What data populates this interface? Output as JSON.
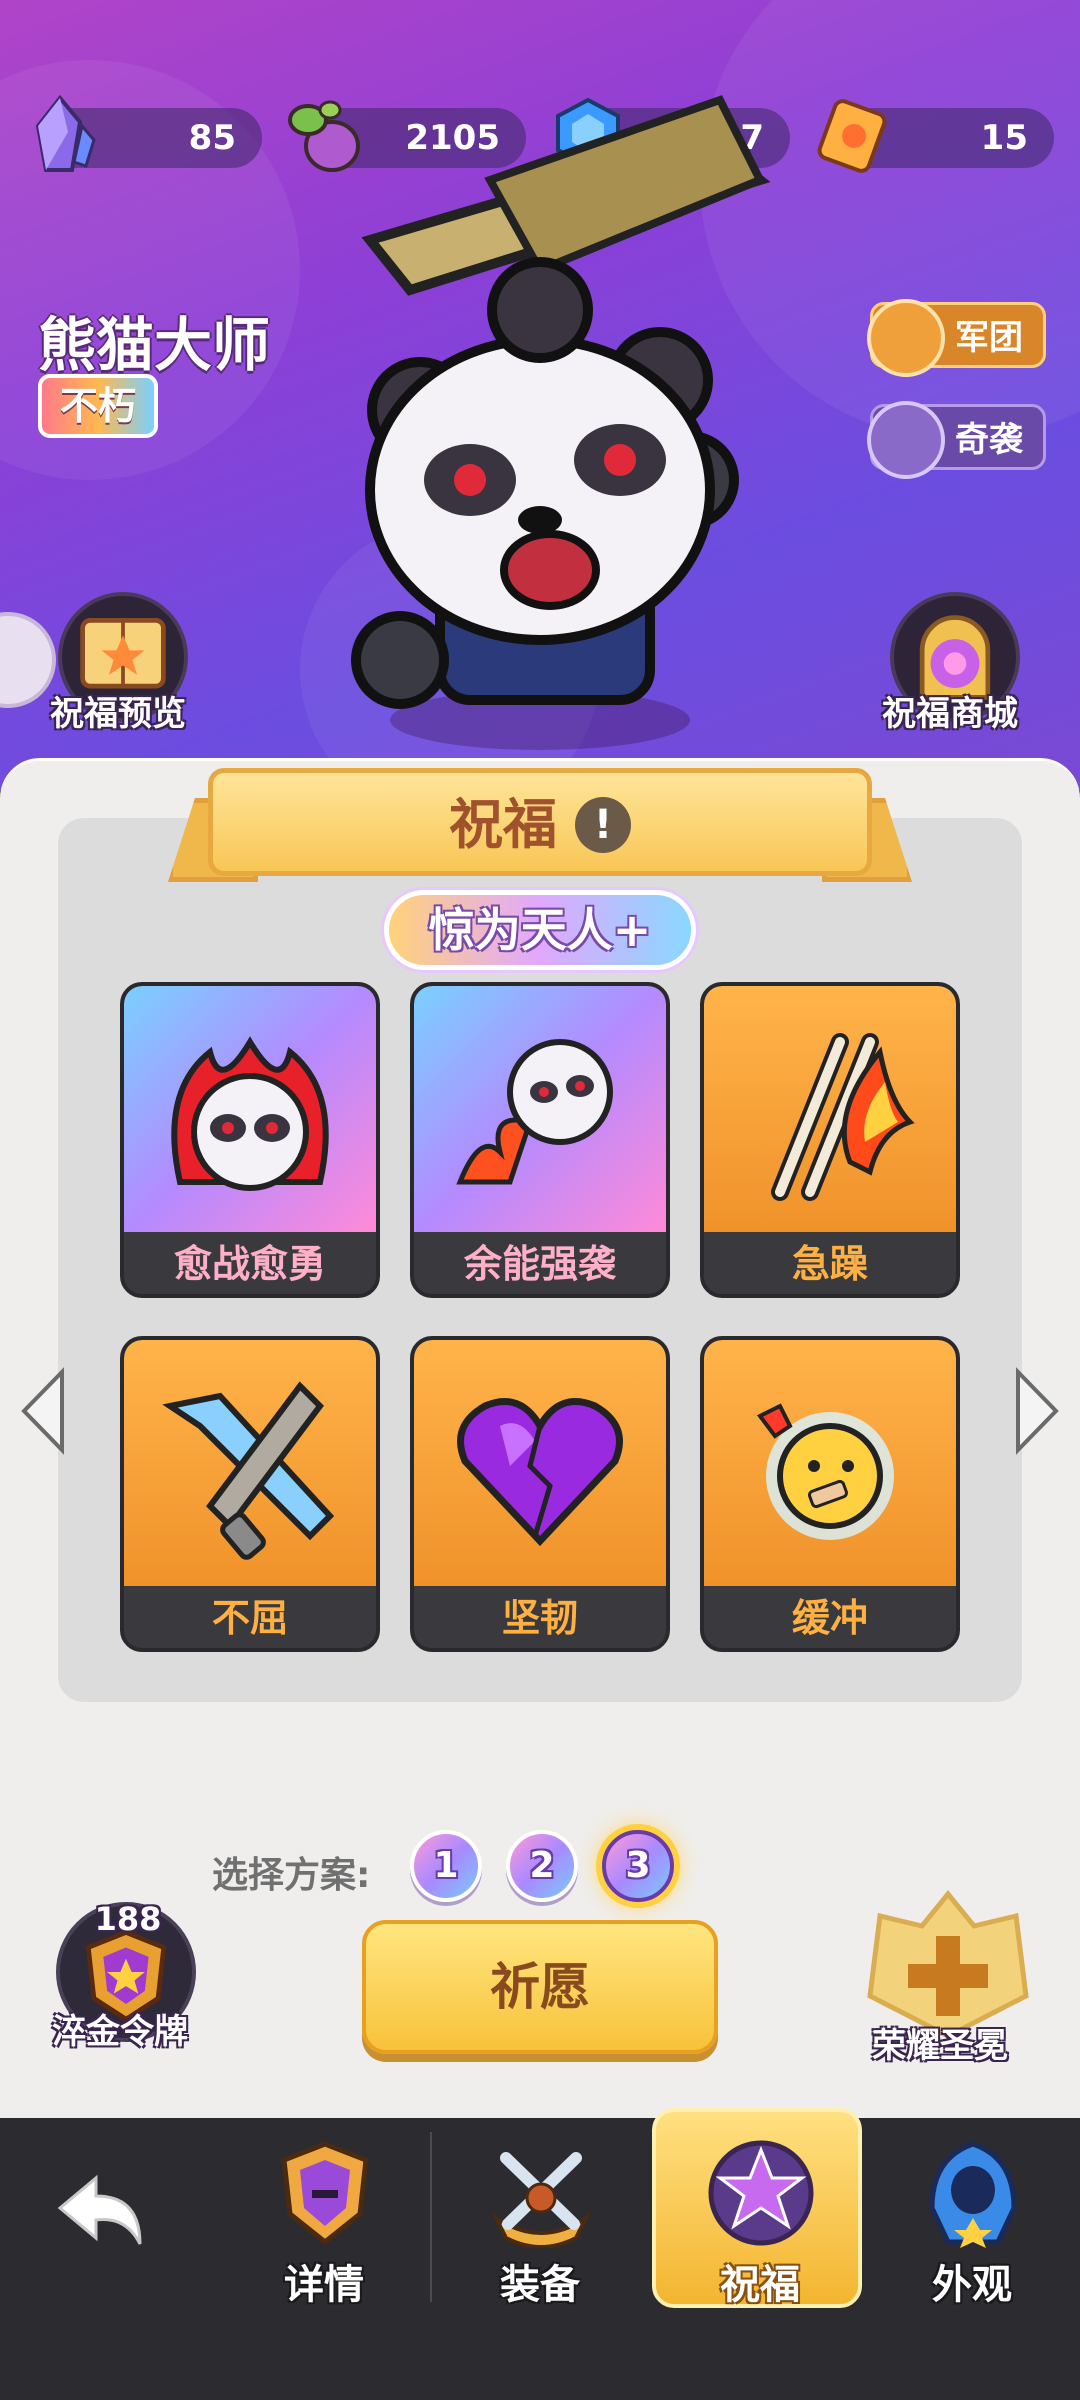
{
  "currencies": [
    {
      "icon": "crystal-icon",
      "value": "85"
    },
    {
      "icon": "gourd-icon",
      "value": "2105"
    },
    {
      "icon": "gem-plus-icon",
      "value": "57"
    },
    {
      "icon": "ticket-icon",
      "value": "15"
    }
  ],
  "hero": {
    "name": "熊猫大师",
    "rank": "不朽"
  },
  "side_buttons": {
    "legion": "军团",
    "raid": "奇袭",
    "blessing_preview": "祝福预览",
    "blessing_shop": "祝福商城"
  },
  "panel": {
    "title": "祝福",
    "info_icon": "!",
    "set_name": "惊为天人+"
  },
  "blessings": [
    {
      "name": "愈战愈勇",
      "tier": "rainbow",
      "icon": "raging-panda-icon"
    },
    {
      "name": "余能强袭",
      "tier": "rainbow",
      "icon": "panda-dash-icon"
    },
    {
      "name": "急躁",
      "tier": "orange",
      "icon": "flaming-claw-icon"
    },
    {
      "name": "不屈",
      "tier": "orange",
      "icon": "crossed-swords-icon"
    },
    {
      "name": "坚韧",
      "tier": "orange",
      "icon": "purple-heart-icon"
    },
    {
      "name": "缓冲",
      "tier": "orange",
      "icon": "bandaged-face-icon"
    }
  ],
  "plan": {
    "label": "选择方案:",
    "options": [
      "1",
      "2",
      "3"
    ],
    "selected": "3"
  },
  "pray_button": "祈愿",
  "token": {
    "count": "188",
    "label": "淬金令牌"
  },
  "crown": {
    "label": "荣耀圣冕"
  },
  "nav": {
    "back": "back-arrow-icon",
    "items": [
      {
        "label": "详情"
      },
      {
        "label": "装备"
      },
      {
        "label": "祝福"
      },
      {
        "label": "外观"
      }
    ],
    "active": "祝福"
  },
  "colors": {
    "hero_bg": "#8d3fd6",
    "panel_bg": "#efeeec",
    "gold": "#f8c23a",
    "nav_bg": "#2b2b30"
  }
}
